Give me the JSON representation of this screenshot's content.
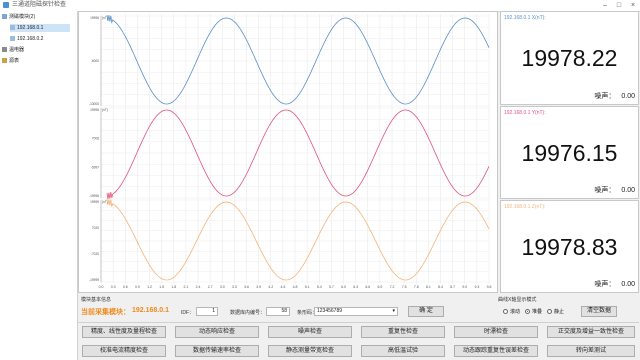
{
  "window": {
    "title": "三通道阻磁探针检查"
  },
  "sidebar": {
    "items": [
      {
        "label": "测磁模块(2)",
        "level": 0
      },
      {
        "label": "192.168.0.1",
        "level": 1
      },
      {
        "label": "192.168.0.2",
        "level": 1
      },
      {
        "label": "温电器",
        "level": 0
      },
      {
        "label": "源表",
        "level": 0
      }
    ]
  },
  "chart_data": [
    {
      "type": "line",
      "series": [
        {
          "name": "X",
          "color": "#5b8fc9"
        }
      ],
      "ylabel": "nT",
      "yticks": [
        "19996",
        "",
        "",
        "",
        "",
        "",
        "-6000",
        "-13000"
      ],
      "xticks": [
        "0.0",
        "0.3",
        "0.6",
        "0.9",
        "1.2",
        "1.5",
        "1.8",
        "2.1",
        "2.4",
        "2.7",
        "3.0",
        "3.3",
        "3.6",
        "3.9",
        "4.2",
        "4.5",
        "4.8",
        "5.1",
        "5.4",
        "5.7",
        "6.0",
        "6.3",
        "6.6",
        "6.9",
        "7.2",
        "7.5",
        "7.8",
        "8.1",
        "8.4",
        "8.7",
        "9.0",
        "9.3",
        "9.6"
      ]
    },
    {
      "type": "line",
      "series": [
        {
          "name": "Y",
          "color": "#e0557a"
        }
      ],
      "ylabel": "nT",
      "yticks": [
        "19996",
        "7006",
        "-5997",
        "-19996"
      ]
    },
    {
      "type": "line",
      "series": [
        {
          "name": "Z",
          "color": "#f5b47a"
        }
      ],
      "ylabel": "nT",
      "yticks": [
        "19999",
        "7020",
        "-7020",
        "-19999"
      ]
    }
  ],
  "panels": [
    {
      "label": "192.168.0.1  X(nT):",
      "value": "19978.22",
      "noise_label": "噪声：",
      "noise_value": "0.00",
      "color": "#5b8fc9"
    },
    {
      "label": "192.168.0.1  Y(nT):",
      "value": "19976.15",
      "noise_label": "噪声：",
      "noise_value": "0.00",
      "color": "#e0557a"
    },
    {
      "label": "192.168.0.1  Z(nT):",
      "value": "19978.83",
      "noise_label": "噪声：",
      "noise_value": "0.00",
      "color": "#f5b47a"
    }
  ],
  "bottom": {
    "section_label": "模块基本信息",
    "current_label": "当前采集模块：",
    "current_ip": "192.168.0.1",
    "idf_label": "IDF：",
    "idf_value": "1",
    "seq_label": "数据库内编号：",
    "seq_value": "58",
    "barcode_label": "条形码：",
    "barcode_value": "123456789",
    "confirm_label": "确 定",
    "mode_label": "曲线X轴显示模式",
    "modes": [
      {
        "label": "滚动",
        "selected": false
      },
      {
        "label": "堆叠",
        "selected": true
      },
      {
        "label": "静止",
        "selected": false
      }
    ],
    "clear_label": "清空数据",
    "buttons_row1": [
      "精度、线性度及量程检查",
      "动态响应检查",
      "噪声检查",
      "重复性检查",
      "时漂检查",
      "正交度及增益一致性检查"
    ],
    "buttons_row2": [
      "校准电流精度检查",
      "数据传输速率检查",
      "静态测量带宽检查",
      "高低温试验",
      "动态跟踪重复性误差检查",
      "转向差测试"
    ]
  }
}
